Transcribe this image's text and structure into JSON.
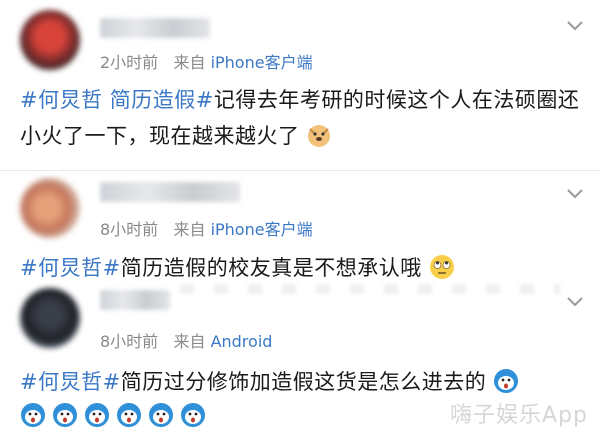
{
  "comments": [
    {
      "time": "2小时前",
      "from_label": "来自",
      "source": "iPhone客户端",
      "tag": "#何炅哲 简历造假#",
      "text": "记得去年考研的时候这个人在法硕圈还小火了一下，现在越来越火了",
      "emoji": "doge-emoji"
    },
    {
      "time": "8小时前",
      "from_label": "来自",
      "source": "iPhone客户端",
      "tag": "#何炅哲#",
      "text": "简历造假的校友真是不想承认哦",
      "emoji": "eye-roll-emoji"
    },
    {
      "time": "8小时前",
      "from_label": "来自",
      "source": "Android",
      "tag": "#何炅哲#",
      "text": "简历过分修饰加造假这货是怎么进去的",
      "emoji": "shocked-emoji"
    }
  ],
  "watermark": "嗨子娱乐App",
  "colors": {
    "link": "#3b78c5",
    "meta": "#8a8a8a",
    "divider": "#e8e8e8"
  }
}
